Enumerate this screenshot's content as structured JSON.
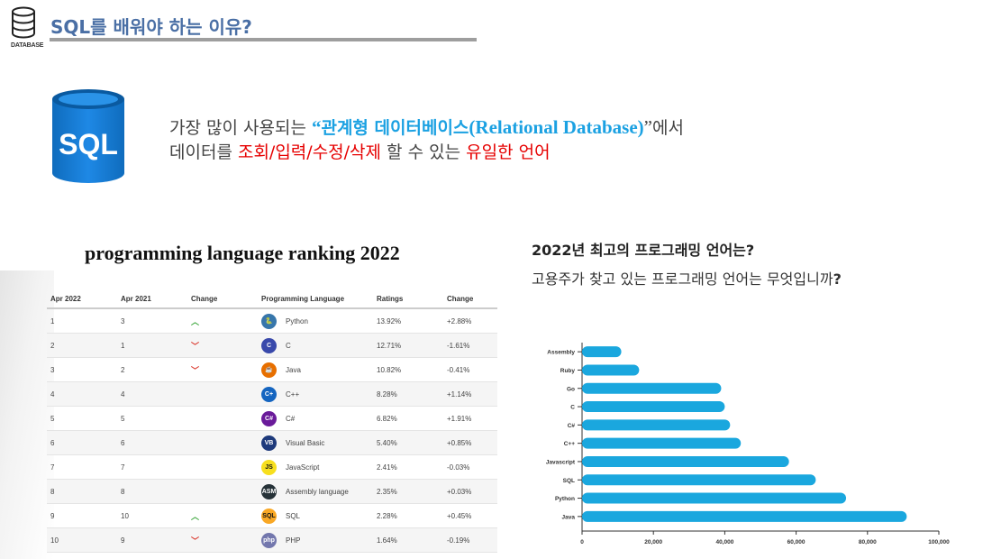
{
  "header": {
    "title": "SQL를 배워야 하는 이유?",
    "icon_label": "DATABASE",
    "icon": "database-icon",
    "rule_color": "#9e9e9e"
  },
  "logo": {
    "text": "SQL",
    "color": "#1a7fd4"
  },
  "intro": {
    "line1_prefix": "가장 많이 사용되는 ",
    "quote_open": "“",
    "highlight_ko": "관계형 데이터베이스",
    "highlight_en": "(Relational Database)",
    "quote_close": "”",
    "line1_suffix": "에서",
    "line2_prefix": "데이터를 ",
    "ops": "조회/입력/수정/삭제",
    "line2_mid": " 할 수 있는 ",
    "unique": "유일한 언어",
    "highlight_color": "#1ba1e2",
    "red_color": "#e60000"
  },
  "ranking": {
    "title": "programming language ranking 2022",
    "columns": [
      "Apr 2022",
      "Apr 2021",
      "Change",
      "Programming Language",
      "Ratings",
      "Change"
    ],
    "rows": [
      {
        "apr2022": "1",
        "apr2021": "3",
        "change": "up",
        "language": "Python",
        "icon": "python-icon",
        "icon_text": "🐍",
        "icon_color": "#3776ab",
        "ratings": "13.92%",
        "delta": "+2.88%"
      },
      {
        "apr2022": "2",
        "apr2021": "1",
        "change": "down",
        "language": "C",
        "icon": "c-icon",
        "icon_text": "C",
        "icon_color": "#3949ab",
        "ratings": "12.71%",
        "delta": "-1.61%"
      },
      {
        "apr2022": "3",
        "apr2021": "2",
        "change": "down",
        "language": "Java",
        "icon": "java-icon",
        "icon_text": "☕",
        "icon_color": "#e76f00",
        "ratings": "10.82%",
        "delta": "-0.41%"
      },
      {
        "apr2022": "4",
        "apr2021": "4",
        "change": "",
        "language": "C++",
        "icon": "cpp-icon",
        "icon_text": "C+",
        "icon_color": "#1565c0",
        "ratings": "8.28%",
        "delta": "+1.14%"
      },
      {
        "apr2022": "5",
        "apr2021": "5",
        "change": "",
        "language": "C#",
        "icon": "csharp-icon",
        "icon_text": "C#",
        "icon_color": "#6a1b9a",
        "ratings": "6.82%",
        "delta": "+1.91%"
      },
      {
        "apr2022": "6",
        "apr2021": "6",
        "change": "",
        "language": "Visual Basic",
        "icon": "visual-basic-icon",
        "icon_text": "VB",
        "icon_color": "#1e3a7b",
        "ratings": "5.40%",
        "delta": "+0.85%"
      },
      {
        "apr2022": "7",
        "apr2021": "7",
        "change": "",
        "language": "JavaScript",
        "icon": "javascript-icon",
        "icon_text": "JS",
        "icon_color": "#f7df1e",
        "ratings": "2.41%",
        "delta": "-0.03%"
      },
      {
        "apr2022": "8",
        "apr2021": "8",
        "change": "",
        "language": "Assembly language",
        "icon": "assembly-icon",
        "icon_text": "ASM",
        "icon_color": "#263238",
        "ratings": "2.35%",
        "delta": "+0.03%"
      },
      {
        "apr2022": "9",
        "apr2021": "10",
        "change": "up",
        "language": "SQL",
        "icon": "sql-icon",
        "icon_text": "SQL",
        "icon_color": "#f9a825",
        "ratings": "2.28%",
        "delta": "+0.45%"
      },
      {
        "apr2022": "10",
        "apr2021": "9",
        "change": "down",
        "language": "PHP",
        "icon": "php-icon",
        "icon_text": "php",
        "icon_color": "#7377ad",
        "ratings": "1.64%",
        "delta": "-0.19%"
      }
    ]
  },
  "question": {
    "title": "2022년 최고의 프로그래밍 언어는?",
    "subtitle": "고용주가 찾고 있는 프로그래밍 언어는 무엇입니까",
    "subtitle_mark": "?"
  },
  "chart_data": {
    "type": "bar",
    "orientation": "horizontal",
    "categories": [
      "Assembly",
      "Ruby",
      "Go",
      "C",
      "C#",
      "C++",
      "Javascript",
      "SQL",
      "Python",
      "Java"
    ],
    "values": [
      11000,
      16000,
      39000,
      40000,
      41500,
      44500,
      58000,
      65500,
      74000,
      91000
    ],
    "xlim": [
      0,
      100000
    ],
    "xticks": [
      "0",
      "20,000",
      "40,000",
      "60,000",
      "80,000",
      "100,000"
    ],
    "xtick_values": [
      0,
      20000,
      40000,
      60000,
      80000,
      100000
    ],
    "bar_color": "#1aa7de",
    "grid": false,
    "title": "",
    "xlabel": "",
    "ylabel": ""
  }
}
